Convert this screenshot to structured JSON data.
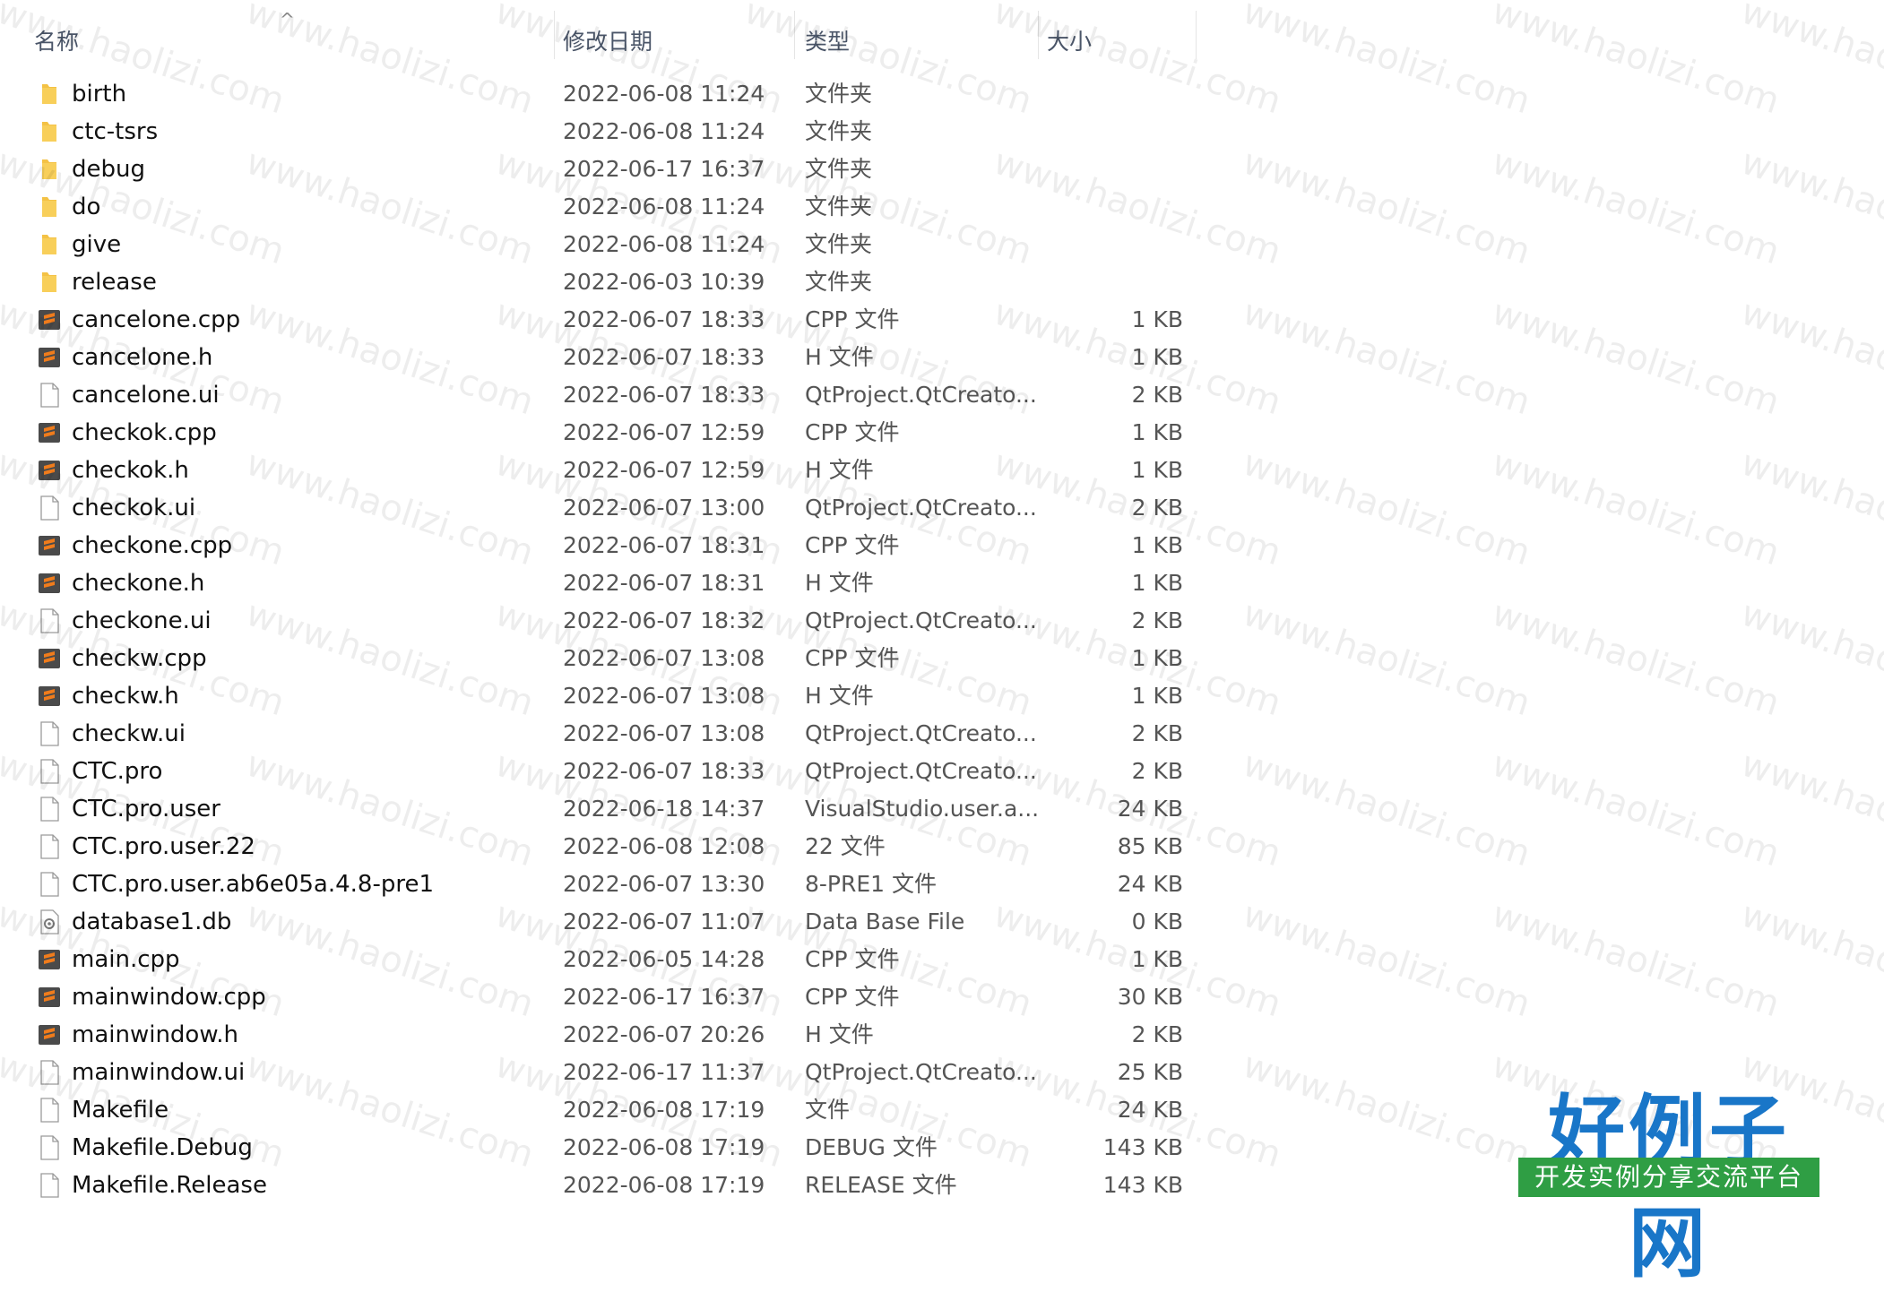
{
  "header": {
    "col_name": "名称",
    "col_date": "修改日期",
    "col_type": "类型",
    "col_size": "大小",
    "sort_indicator": "^"
  },
  "watermark": "www.haolizi.com",
  "logo": {
    "title": "好例子网",
    "subtitle": "开发实例分享交流平台"
  },
  "colors": {
    "folder": "#f4c245",
    "sublime": "#4a4a4a",
    "sublime_accent": "#f07c1c",
    "accent": "#1976c8"
  },
  "files": [
    {
      "name": "birth",
      "date": "2022-06-08 11:24",
      "type": "文件夹",
      "size": "",
      "icon": "folder-icon"
    },
    {
      "name": "ctc-tsrs",
      "date": "2022-06-08 11:24",
      "type": "文件夹",
      "size": "",
      "icon": "folder-icon"
    },
    {
      "name": "debug",
      "date": "2022-06-17 16:37",
      "type": "文件夹",
      "size": "",
      "icon": "folder-icon"
    },
    {
      "name": "do",
      "date": "2022-06-08 11:24",
      "type": "文件夹",
      "size": "",
      "icon": "folder-icon"
    },
    {
      "name": "give",
      "date": "2022-06-08 11:24",
      "type": "文件夹",
      "size": "",
      "icon": "folder-icon"
    },
    {
      "name": "release",
      "date": "2022-06-03 10:39",
      "type": "文件夹",
      "size": "",
      "icon": "folder-icon"
    },
    {
      "name": "cancelone.cpp",
      "date": "2022-06-07 18:33",
      "type": "CPP 文件",
      "size": "1 KB",
      "icon": "sublime-file-icon"
    },
    {
      "name": "cancelone.h",
      "date": "2022-06-07 18:33",
      "type": "H 文件",
      "size": "1 KB",
      "icon": "sublime-file-icon"
    },
    {
      "name": "cancelone.ui",
      "date": "2022-06-07 18:33",
      "type": "QtProject.QtCreato...",
      "size": "2 KB",
      "icon": "blank-file-icon"
    },
    {
      "name": "checkok.cpp",
      "date": "2022-06-07 12:59",
      "type": "CPP 文件",
      "size": "1 KB",
      "icon": "sublime-file-icon"
    },
    {
      "name": "checkok.h",
      "date": "2022-06-07 12:59",
      "type": "H 文件",
      "size": "1 KB",
      "icon": "sublime-file-icon"
    },
    {
      "name": "checkok.ui",
      "date": "2022-06-07 13:00",
      "type": "QtProject.QtCreato...",
      "size": "2 KB",
      "icon": "blank-file-icon"
    },
    {
      "name": "checkone.cpp",
      "date": "2022-06-07 18:31",
      "type": "CPP 文件",
      "size": "1 KB",
      "icon": "sublime-file-icon"
    },
    {
      "name": "checkone.h",
      "date": "2022-06-07 18:31",
      "type": "H 文件",
      "size": "1 KB",
      "icon": "sublime-file-icon"
    },
    {
      "name": "checkone.ui",
      "date": "2022-06-07 18:32",
      "type": "QtProject.QtCreato...",
      "size": "2 KB",
      "icon": "blank-file-icon"
    },
    {
      "name": "checkw.cpp",
      "date": "2022-06-07 13:08",
      "type": "CPP 文件",
      "size": "1 KB",
      "icon": "sublime-file-icon"
    },
    {
      "name": "checkw.h",
      "date": "2022-06-07 13:08",
      "type": "H 文件",
      "size": "1 KB",
      "icon": "sublime-file-icon"
    },
    {
      "name": "checkw.ui",
      "date": "2022-06-07 13:08",
      "type": "QtProject.QtCreato...",
      "size": "2 KB",
      "icon": "blank-file-icon"
    },
    {
      "name": "CTC.pro",
      "date": "2022-06-07 18:33",
      "type": "QtProject.QtCreato...",
      "size": "2 KB",
      "icon": "blank-file-icon"
    },
    {
      "name": "CTC.pro.user",
      "date": "2022-06-18 14:37",
      "type": "VisualStudio.user.a...",
      "size": "24 KB",
      "icon": "blank-file-icon"
    },
    {
      "name": "CTC.pro.user.22",
      "date": "2022-06-08 12:08",
      "type": "22 文件",
      "size": "85 KB",
      "icon": "blank-file-icon"
    },
    {
      "name": "CTC.pro.user.ab6e05a.4.8-pre1",
      "date": "2022-06-07 13:30",
      "type": "8-PRE1 文件",
      "size": "24 KB",
      "icon": "blank-file-icon"
    },
    {
      "name": "database1.db",
      "date": "2022-06-07 11:07",
      "type": "Data Base File",
      "size": "0 KB",
      "icon": "database-file-icon"
    },
    {
      "name": "main.cpp",
      "date": "2022-06-05 14:28",
      "type": "CPP 文件",
      "size": "1 KB",
      "icon": "sublime-file-icon"
    },
    {
      "name": "mainwindow.cpp",
      "date": "2022-06-17 16:37",
      "type": "CPP 文件",
      "size": "30 KB",
      "icon": "sublime-file-icon"
    },
    {
      "name": "mainwindow.h",
      "date": "2022-06-07 20:26",
      "type": "H 文件",
      "size": "2 KB",
      "icon": "sublime-file-icon"
    },
    {
      "name": "mainwindow.ui",
      "date": "2022-06-17 11:37",
      "type": "QtProject.QtCreato...",
      "size": "25 KB",
      "icon": "blank-file-icon"
    },
    {
      "name": "Makefile",
      "date": "2022-06-08 17:19",
      "type": "文件",
      "size": "24 KB",
      "icon": "blank-file-icon"
    },
    {
      "name": "Makefile.Debug",
      "date": "2022-06-08 17:19",
      "type": "DEBUG 文件",
      "size": "143 KB",
      "icon": "blank-file-icon"
    },
    {
      "name": "Makefile.Release",
      "date": "2022-06-08 17:19",
      "type": "RELEASE 文件",
      "size": "143 KB",
      "icon": "blank-file-icon"
    }
  ]
}
